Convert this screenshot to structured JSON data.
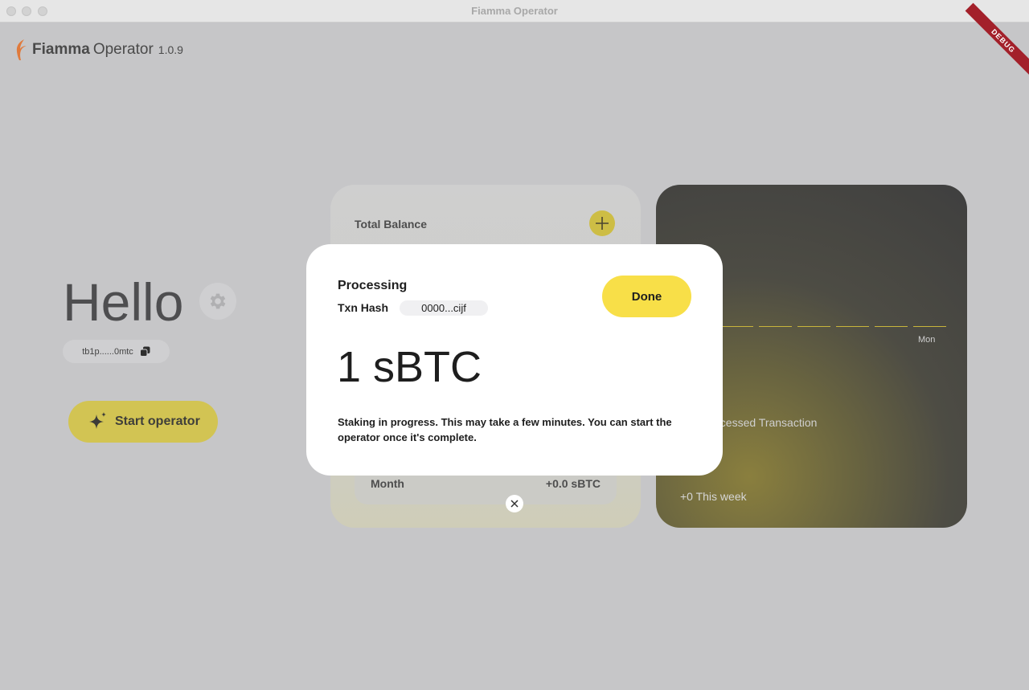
{
  "window": {
    "title": "Fiamma Operator",
    "debug_badge": "DEBUG"
  },
  "logo": {
    "name": "Fiamma",
    "product": "Operator",
    "version": "1.0.9"
  },
  "greeting": {
    "text": "Hello",
    "address": "tb1p......0mtc"
  },
  "start_button": {
    "label": "Start operator"
  },
  "balance_card": {
    "title": "Total Balance",
    "month_label": "Month",
    "month_value": "+0.0 sBTC"
  },
  "stats_card": {
    "day_label": "Mon",
    "processed_label": "ocessed Transaction",
    "week_label": "+0 This week"
  },
  "modal": {
    "title": "Processing",
    "txn_label": "Txn Hash",
    "txn_hash": "0000...cijf",
    "done_label": "Done",
    "amount": "1 sBTC",
    "message": "Staking in progress. This may take a few minutes. You can start the operator once it's complete."
  },
  "colors": {
    "accent": "#f8df48",
    "background": "#c6c6c8",
    "logo_orange": "#e07a3c"
  },
  "icons": [
    "flame-logo-icon",
    "gear-icon",
    "copy-icon",
    "sparkle-icon",
    "plus-icon",
    "close-icon"
  ]
}
